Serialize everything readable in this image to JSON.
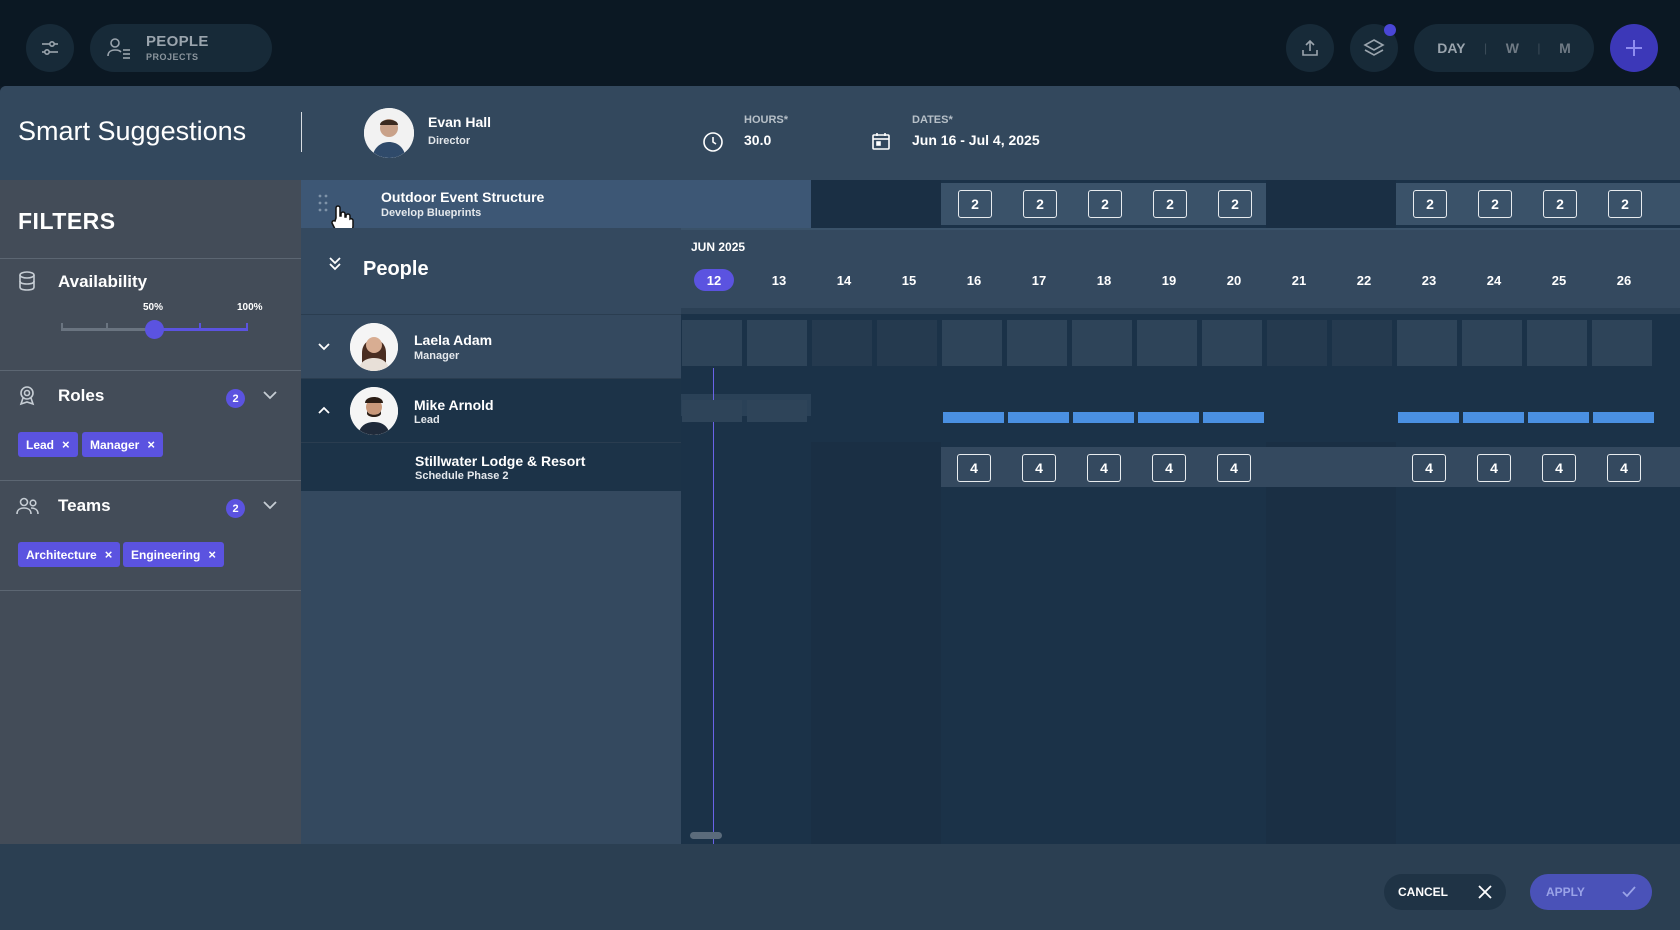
{
  "topbar": {
    "people_label": "PEOPLE",
    "projects_label": "PROJECTS",
    "view_day": "DAY",
    "view_week": "W",
    "view_month": "M"
  },
  "header": {
    "title": "Smart Suggestions",
    "person_name": "Evan Hall",
    "person_role": "Director",
    "hours_label": "HOURS*",
    "hours_value": "30.0",
    "dates_label": "DATES*",
    "dates_value": "Jun 16 - Jul 4, 2025"
  },
  "filters": {
    "title": "FILTERS",
    "availability": {
      "label": "Availability",
      "min_label": "50%",
      "max_label": "100%",
      "range": [
        50,
        100
      ]
    },
    "roles": {
      "label": "Roles",
      "count": "2",
      "chips": [
        "Lead",
        "Manager"
      ]
    },
    "teams": {
      "label": "Teams",
      "count": "2",
      "chips": [
        "Architecture",
        "Engineering"
      ]
    }
  },
  "dragged_task": {
    "project": "Outdoor Event Structure",
    "task": "Develop Blueprints",
    "hours": [
      "2",
      "2",
      "2",
      "2",
      "2",
      "2",
      "2",
      "2",
      "2"
    ]
  },
  "people_section": {
    "title": "People",
    "month_label": "JUN 2025",
    "dates": [
      "12",
      "13",
      "14",
      "15",
      "16",
      "17",
      "18",
      "19",
      "20",
      "21",
      "22",
      "23",
      "24",
      "25",
      "26"
    ]
  },
  "people": [
    {
      "name": "Laela Adam",
      "role": "Manager"
    },
    {
      "name": "Mike Arnold",
      "role": "Lead"
    }
  ],
  "assignment": {
    "project": "Stillwater Lodge & Resort",
    "task": "Schedule Phase 2",
    "hours": [
      "4",
      "4",
      "4",
      "4",
      "4",
      "4",
      "4",
      "4",
      "4"
    ]
  },
  "footer": {
    "cancel_label": "CANCEL",
    "apply_label": "APPLY"
  },
  "colors": {
    "accent": "#5b53e0",
    "bar": "#4a90e2",
    "background": "#0d1a26"
  }
}
